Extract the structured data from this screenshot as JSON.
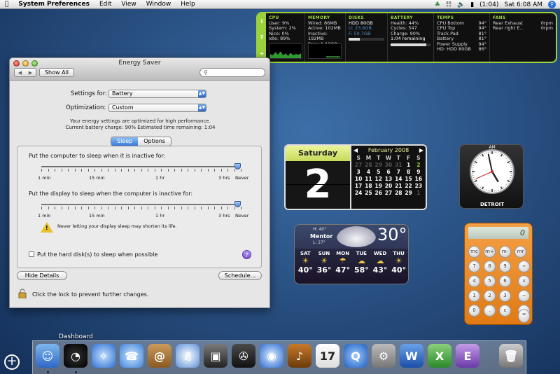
{
  "menubar": {
    "apple_icon": "apple-icon",
    "app_name": "System Preferences",
    "items": [
      "Edit",
      "View",
      "Window",
      "Help"
    ],
    "battery_text": "(1:04)",
    "clock": "Sat 6:08 AM"
  },
  "istat": {
    "sidebar": [
      "i",
      "?",
      "+"
    ],
    "cpu": {
      "title": "CPU",
      "user": "User: 9%",
      "system": "System: 2%",
      "nice": "Nice: 0%",
      "idle": "Idle: 89%"
    },
    "memory": {
      "title": "MEMORY",
      "wired": "Wired: 86MB",
      "active": "Active: 102MB",
      "inactive": "Inactive: 192MB",
      "free": "Free: 1.13GB"
    },
    "disks": {
      "title": "DISKS",
      "name": "HDD 80GB",
      "used": "U: 23.6GB",
      "free": "F: 50.7GB",
      "used_fraction": 0.32
    },
    "battery": {
      "title": "BATTERY",
      "health": "Health: 44%",
      "cycles": "Cycles: 547",
      "charge": "Charge: 90%",
      "remaining": "1:04 remaining",
      "charge_fraction": 0.9
    },
    "temps": {
      "title": "TEMPS",
      "labels": [
        "CPU Bottom",
        "CPU Top",
        "Track Pad",
        "Battery",
        "Power Supply",
        "HD: HDD 80GB"
      ],
      "values": [
        "94°",
        "94°",
        "81°",
        "81°",
        "94°",
        "86°"
      ]
    },
    "fans": {
      "title": "FANS",
      "labels": [
        "Rear Exhaust",
        "Rear right E..."
      ],
      "values": [
        "0rpm",
        "0rpm"
      ]
    }
  },
  "energy_saver": {
    "title": "Energy Saver",
    "show_all": "Show All",
    "search_placeholder": "",
    "settings_for_label": "Settings for:",
    "settings_for_value": "Battery",
    "optimization_label": "Optimization:",
    "optimization_value": "Custom",
    "info_line1": "Your energy settings are optimized for high performance.",
    "info_line2": "Current battery charge: 90%  Estimated time remaining: 1:04",
    "tabs": [
      "Sleep",
      "Options"
    ],
    "computer_sleep_label": "Put the computer to sleep when it is inactive for:",
    "display_sleep_label": "Put the display to sleep when the computer is inactive for:",
    "tick_labels": [
      "1 min",
      "15 min",
      "1 hr",
      "3 hrs",
      "Never"
    ],
    "computer_sleep_value": "Never",
    "display_sleep_value": "Never",
    "warning_text": "Never letting your display sleep may shorten its life.",
    "hard_disk_label": "Put the hard disk(s) to sleep when possible",
    "hard_disk_checked": false,
    "help_label": "?",
    "hide_details": "Hide Details",
    "schedule": "Schedule...",
    "lock_text": "Click the lock to prevent further changes."
  },
  "calendar": {
    "day_name": "Saturday",
    "day_number": "2",
    "month": "February 2008",
    "weekday_headers": [
      "S",
      "M",
      "T",
      "W",
      "T",
      "F",
      "S"
    ],
    "days": [
      "27",
      "28",
      "29",
      "30",
      "31",
      "1",
      "2",
      "3",
      "4",
      "5",
      "6",
      "7",
      "8",
      "9",
      "10",
      "11",
      "12",
      "13",
      "14",
      "15",
      "16",
      "17",
      "18",
      "19",
      "20",
      "21",
      "22",
      "23",
      "24",
      "25",
      "26",
      "27",
      "28",
      "29",
      "1"
    ],
    "prev": "◀",
    "next": "▶"
  },
  "clock": {
    "top_label": "AM",
    "city": "DETROIT",
    "hour": 4,
    "minute": 58,
    "second": 41
  },
  "weather": {
    "city": "Mentor",
    "high": "H: 40°",
    "low": "L: 27°",
    "current": "30°",
    "days": [
      "SAT",
      "SUN",
      "MON",
      "TUE",
      "WED",
      "THU"
    ],
    "temps": [
      "40°",
      "36°",
      "47°",
      "58°",
      "43°",
      "40°"
    ],
    "icons": [
      "sun-cloud-icon",
      "sun-cloud-icon",
      "rain-icon",
      "cloud-icon",
      "cloud-icon",
      "sun-cloud-icon"
    ]
  },
  "calculator": {
    "display": "0",
    "keys": [
      "mc",
      "m+",
      "m-",
      "mr",
      "7",
      "8",
      "9",
      "4",
      "5",
      "6",
      "1",
      "2",
      "3",
      "0",
      ".",
      "c",
      "÷",
      "×",
      "−",
      "+",
      "="
    ]
  },
  "dashboard_label": "Dashboard",
  "add_widget_icon": "plus-circle-icon",
  "dock": {
    "apps": [
      "finder-icon",
      "dashboard-icon",
      "safari-icon",
      "ichat-icon",
      "address-book-icon",
      "itunes-icon",
      "iphoto-icon",
      "imovie-icon",
      "idvd-icon",
      "garageband-icon",
      "ical-icon",
      "quicktime-icon",
      "system-preferences-icon",
      "word-icon",
      "excel-icon",
      "entourage-icon",
      "trash-icon"
    ]
  }
}
